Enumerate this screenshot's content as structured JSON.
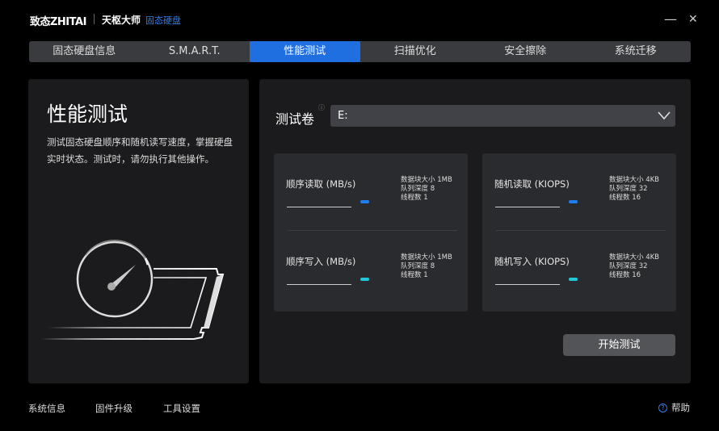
{
  "titlebar": {
    "brand": "致态ZHITAI",
    "app": "天枢大师",
    "subtitle": "固态硬盘",
    "minimize": "—",
    "close": "✕"
  },
  "tabs": [
    {
      "label": "固态硬盘信息"
    },
    {
      "label": "S.M.A.R.T."
    },
    {
      "label": "性能测试"
    },
    {
      "label": "扫描优化"
    },
    {
      "label": "安全擦除"
    },
    {
      "label": "系统迁移"
    }
  ],
  "left": {
    "title": "性能测试",
    "description": "测试固态硬盘顺序和随机读写速度，掌握硬盘实时状态。测试时，请勿执行其他操作。"
  },
  "volume": {
    "label": "测试卷",
    "info": "ⓘ",
    "value": "E:"
  },
  "metrics": [
    {
      "name": "顺序读取 (MB/s)",
      "block": "数据块大小 1MB",
      "queue": "队列深度 8",
      "threads": "线程数 1",
      "color": "#1f7ff0"
    },
    {
      "name": "顺序写入 (MB/s)",
      "block": "数据块大小 1MB",
      "queue": "队列深度 8",
      "threads": "线程数 1",
      "color": "#20c8d8"
    },
    {
      "name": "随机读取 (KIOPS)",
      "block": "数据块大小 4KB",
      "queue": "队列深度 32",
      "threads": "线程数 16",
      "color": "#1f7ff0"
    },
    {
      "name": "随机写入 (KIOPS)",
      "block": "数据块大小 4KB",
      "queue": "队列深度 32",
      "threads": "线程数 16",
      "color": "#20c8d8"
    }
  ],
  "start_button": "开始测试",
  "footer": {
    "system_info": "系统信息",
    "firmware": "固件升级",
    "settings": "工具设置",
    "help": "帮助",
    "help_icon": "?"
  }
}
